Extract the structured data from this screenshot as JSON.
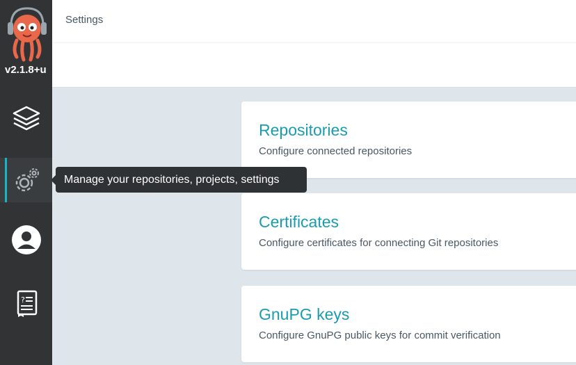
{
  "app": {
    "version": "v2.1.8+u"
  },
  "sidebar": {
    "items": [
      {
        "icon": "layers-icon"
      },
      {
        "icon": "gear-icon",
        "active": true
      },
      {
        "icon": "user-icon"
      },
      {
        "icon": "docs-icon"
      }
    ],
    "tooltip": "Manage your repositories, projects, settings"
  },
  "header": {
    "title": "Settings"
  },
  "cards": [
    {
      "title": "Repositories",
      "description": "Configure connected repositories"
    },
    {
      "title": "Certificates",
      "description": "Configure certificates for connecting Git repositories"
    },
    {
      "title": "GnuPG keys",
      "description": "Configure GnuPG public keys for commit verification"
    }
  ],
  "colors": {
    "sidebar_bg": "#313335",
    "accent": "#18b5c8",
    "card_title": "#1a9cae",
    "page_bg": "#dee6eb"
  }
}
